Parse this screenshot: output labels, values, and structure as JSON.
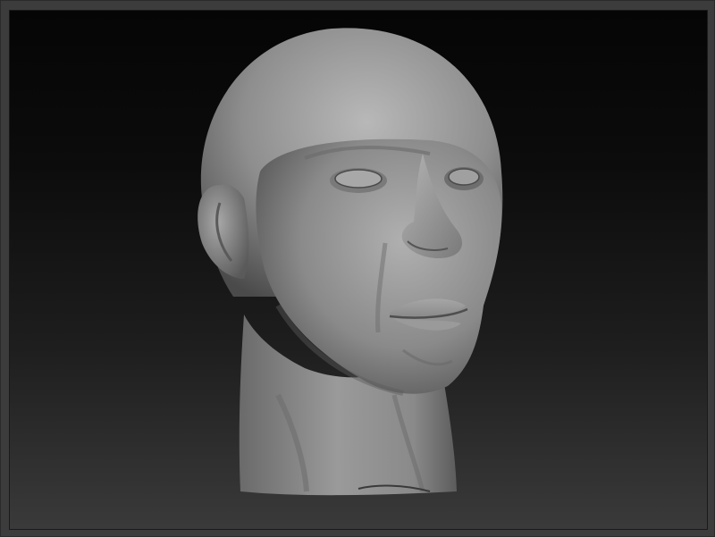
{
  "canvas": {
    "subject": "sculpted-head",
    "colors": {
      "background_top": "#050505",
      "background_bottom": "#3a3a3a",
      "frame": "#3c3c3c",
      "material_light": "#b4b4b4",
      "material_mid": "#8a8a8a",
      "material_dark": "#4e4e4e"
    }
  }
}
